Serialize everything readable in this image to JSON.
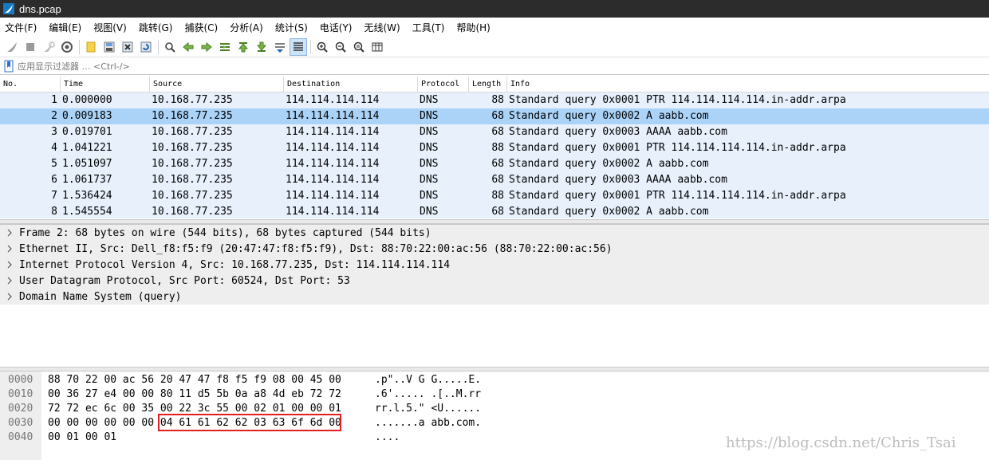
{
  "window": {
    "title": "dns.pcap"
  },
  "menu": [
    "文件(F)",
    "编辑(E)",
    "视图(V)",
    "跳转(G)",
    "捕获(C)",
    "分析(A)",
    "统计(S)",
    "电话(Y)",
    "无线(W)",
    "工具(T)",
    "帮助(H)"
  ],
  "toolbar": {
    "icons": [
      "shark-fin-start-icon",
      "stop-capture-icon",
      "restart-capture-icon",
      "capture-options-icon",
      "open-file-icon",
      "save-file-icon",
      "close-file-icon",
      "reload-file-icon",
      "find-packet-icon",
      "go-back-icon",
      "go-forward-icon",
      "go-to-packet-icon",
      "go-first-icon",
      "go-last-icon",
      "autoscroll-icon",
      "colorize-icon",
      "zoom-in-icon",
      "zoom-out-icon",
      "zoom-normal-icon",
      "resize-columns-icon"
    ],
    "active_icon": "colorize-icon"
  },
  "filter": {
    "placeholder": "应用显示过滤器 … <Ctrl-/>"
  },
  "packet_list": {
    "columns": [
      "No.",
      "Time",
      "Source",
      "Destination",
      "Protocol",
      "Length",
      "Info"
    ],
    "selected_index": 1,
    "rows": [
      {
        "no": "1",
        "time": "0.000000",
        "source": "10.168.77.235",
        "destination": "114.114.114.114",
        "protocol": "DNS",
        "length": "88",
        "info": "Standard query 0x0001 PTR 114.114.114.114.in-addr.arpa"
      },
      {
        "no": "2",
        "time": "0.009183",
        "source": "10.168.77.235",
        "destination": "114.114.114.114",
        "protocol": "DNS",
        "length": "68",
        "info": "Standard query 0x0002 A aabb.com"
      },
      {
        "no": "3",
        "time": "0.019701",
        "source": "10.168.77.235",
        "destination": "114.114.114.114",
        "protocol": "DNS",
        "length": "68",
        "info": "Standard query 0x0003 AAAA aabb.com"
      },
      {
        "no": "4",
        "time": "1.041221",
        "source": "10.168.77.235",
        "destination": "114.114.114.114",
        "protocol": "DNS",
        "length": "88",
        "info": "Standard query 0x0001 PTR 114.114.114.114.in-addr.arpa"
      },
      {
        "no": "5",
        "time": "1.051097",
        "source": "10.168.77.235",
        "destination": "114.114.114.114",
        "protocol": "DNS",
        "length": "68",
        "info": "Standard query 0x0002 A aabb.com"
      },
      {
        "no": "6",
        "time": "1.061737",
        "source": "10.168.77.235",
        "destination": "114.114.114.114",
        "protocol": "DNS",
        "length": "68",
        "info": "Standard query 0x0003 AAAA aabb.com"
      },
      {
        "no": "7",
        "time": "1.536424",
        "source": "10.168.77.235",
        "destination": "114.114.114.114",
        "protocol": "DNS",
        "length": "88",
        "info": "Standard query 0x0001 PTR 114.114.114.114.in-addr.arpa"
      },
      {
        "no": "8",
        "time": "1.545554",
        "source": "10.168.77.235",
        "destination": "114.114.114.114",
        "protocol": "DNS",
        "length": "68",
        "info": "Standard query 0x0002 A aabb.com"
      }
    ]
  },
  "details": [
    "Frame 2: 68 bytes on wire (544 bits), 68 bytes captured (544 bits)",
    "Ethernet II, Src: Dell_f8:f5:f9 (20:47:47:f8:f5:f9), Dst: 88:70:22:00:ac:56 (88:70:22:00:ac:56)",
    "Internet Protocol Version 4, Src: 10.168.77.235, Dst: 114.114.114.114",
    "User Datagram Protocol, Src Port: 60524, Dst Port: 53",
    "Domain Name System (query)"
  ],
  "bytes": [
    {
      "offset": "0000",
      "hex": "88 70 22 00 ac 56 20 47  47 f8 f5 f9 08 00 45 00",
      "ascii": ".p\"..V G G.....E."
    },
    {
      "offset": "0010",
      "hex": "00 36 27 e4 00 00 80 11  d5 5b 0a a8 4d eb 72 72",
      "ascii": ".6'..... .[..M.rr"
    },
    {
      "offset": "0020",
      "hex": "72 72 ec 6c 00 35 00 22  3c 55 00 02 01 00 00 01",
      "ascii": "rr.l.5.\" <U......"
    },
    {
      "offset": "0030",
      "hex": "00 00 00 00 00 00 04 61  61 62 62 03 63 6f 6d 00",
      "ascii": ".......a abb.com."
    },
    {
      "offset": "0040",
      "hex": "00 01 00 01",
      "ascii": "...."
    }
  ],
  "watermark": "https://blog.csdn.net/Chris_Tsai",
  "colors": {
    "row_bg": "#e7f0fb",
    "row_selected": "#abd3f8",
    "highlight": "#e02020",
    "titlebar": "#2c2c2c"
  }
}
